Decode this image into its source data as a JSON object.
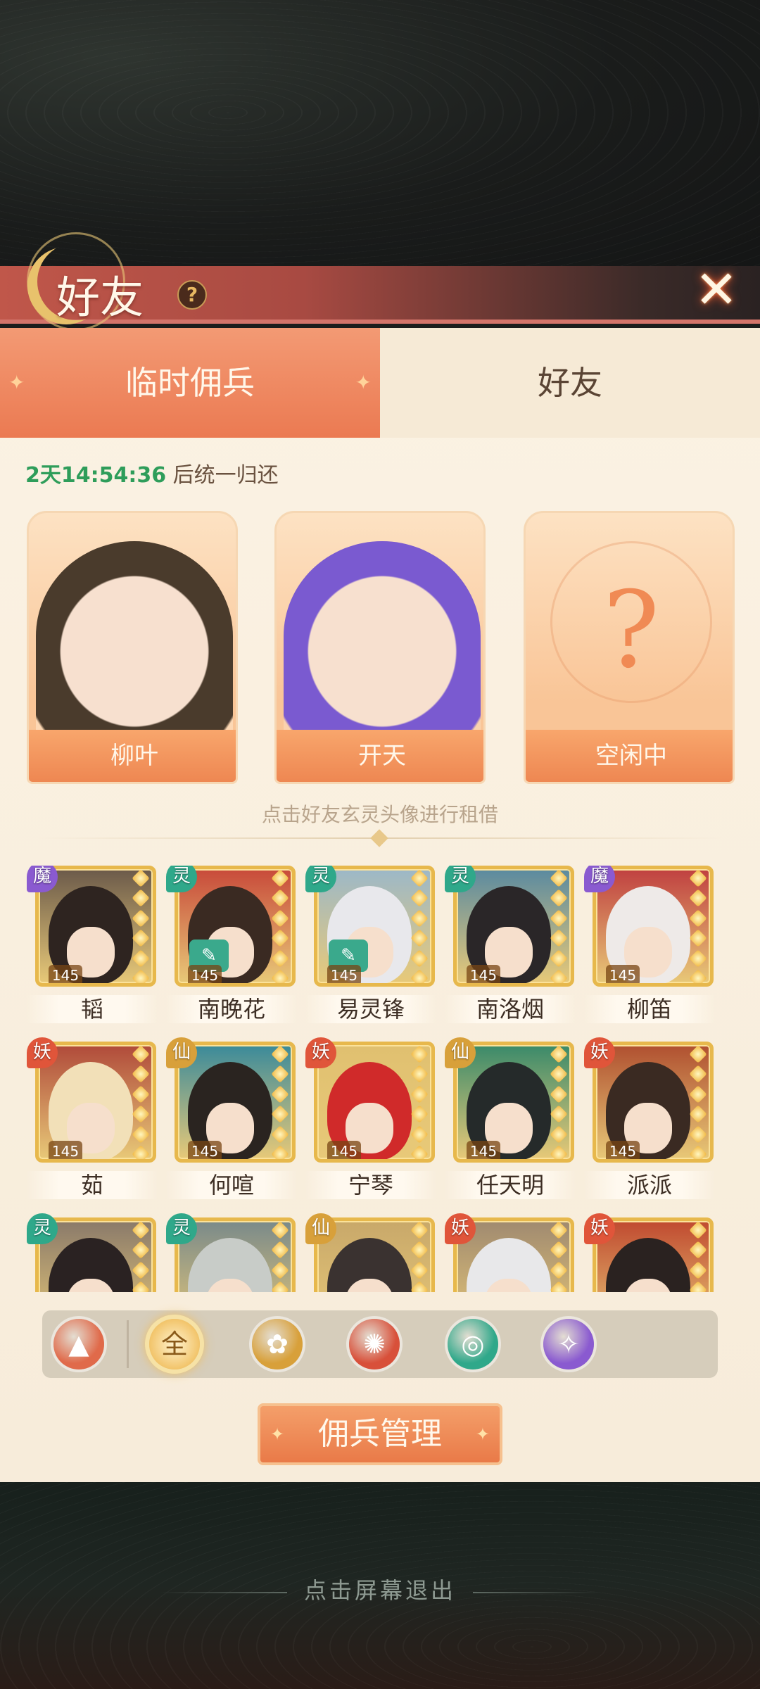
{
  "header": {
    "title": "好友",
    "help": "?",
    "close": "✕"
  },
  "tabs": [
    {
      "label": "临时佣兵",
      "active": true
    },
    {
      "label": "好友",
      "active": false
    }
  ],
  "timer": {
    "time": "2天14:54:36",
    "suffix": " 后统一归还"
  },
  "mercenaries": [
    {
      "name": "柳叶",
      "hair": "#4a3b2c",
      "bg": "#fdd8b4"
    },
    {
      "name": "开天",
      "hair": "#7a5ad0",
      "bg": "#fbd2ad"
    },
    {
      "name": "空闲中",
      "placeholder": "?"
    }
  ],
  "rent_hint": "点击好友玄灵头像进行租借",
  "characters": [
    {
      "name": "韬",
      "element": "魔",
      "level": "145",
      "color": "#8a5ad0",
      "hair": "#2e2420",
      "bg": "#6b5a4a",
      "lent": false
    },
    {
      "name": "南晚花",
      "element": "灵",
      "level": "145",
      "color": "#2fa88a",
      "hair": "#3a2a22",
      "bg": "#c84a3a",
      "lent": true
    },
    {
      "name": "易灵锋",
      "element": "灵",
      "level": "145",
      "color": "#2fa88a",
      "hair": "#e8e8ec",
      "bg": "#9cb8c8",
      "lent": true
    },
    {
      "name": "南洛烟",
      "element": "灵",
      "level": "145",
      "color": "#2fa88a",
      "hair": "#2a2628",
      "bg": "#5a8aa0",
      "lent": false
    },
    {
      "name": "柳笛",
      "element": "魔",
      "level": "145",
      "color": "#8a5ad0",
      "hair": "#eeeae8",
      "bg": "#c04040",
      "lent": false
    },
    {
      "name": "茹",
      "element": "妖",
      "level": "145",
      "color": "#e0553a",
      "hair": "#f2e0b8",
      "bg": "#b04a3a",
      "lent": false
    },
    {
      "name": "何喧",
      "element": "仙",
      "level": "145",
      "color": "#d8a03a",
      "hair": "#2a2420",
      "bg": "#3a8a9a",
      "lent": false
    },
    {
      "name": "宁琴",
      "element": "妖",
      "level": "145",
      "color": "#e0553a",
      "hair": "#d02a2a",
      "bg": "#e0c070",
      "lent": false
    },
    {
      "name": "任天明",
      "element": "仙",
      "level": "145",
      "color": "#d8a03a",
      "hair": "#252a2a",
      "bg": "#3a8a6a",
      "lent": false
    },
    {
      "name": "派派",
      "element": "妖",
      "level": "145",
      "color": "#e0553a",
      "hair": "#3a2a22",
      "bg": "#b05030",
      "lent": false
    },
    {
      "name": "",
      "element": "灵",
      "level": "",
      "color": "#2fa88a",
      "hair": "#2a2222",
      "bg": "#8a7a6a",
      "lent": false
    },
    {
      "name": "",
      "element": "灵",
      "level": "",
      "color": "#2fa88a",
      "hair": "#c8ccc8",
      "bg": "#7a8a8a",
      "lent": false
    },
    {
      "name": "",
      "element": "仙",
      "level": "",
      "color": "#d8a03a",
      "hair": "#3a3230",
      "bg": "#c8a86a",
      "lent": false
    },
    {
      "name": "",
      "element": "妖",
      "level": "",
      "color": "#e0553a",
      "hair": "#e8e8ea",
      "bg": "#a08a70",
      "lent": false
    },
    {
      "name": "",
      "element": "妖",
      "level": "",
      "color": "#e0553a",
      "hair": "#2a2220",
      "bg": "#c04a30",
      "lent": false
    }
  ],
  "filters": [
    {
      "label": "▲",
      "icon": "triangle-icon",
      "color": "#e06a4a"
    },
    {
      "label": "全",
      "icon": "all-icon",
      "color": "#d8a24a",
      "active": true
    },
    {
      "label": "✿",
      "icon": "lotus-icon",
      "color": "#d8a03a"
    },
    {
      "label": "✺",
      "icon": "demon-icon",
      "color": "#d8503a"
    },
    {
      "label": "◎",
      "icon": "spirit-icon",
      "color": "#2fa88a"
    },
    {
      "label": "✧",
      "icon": "mo-icon",
      "color": "#8a5ad0"
    }
  ],
  "manage_button": "佣兵管理",
  "exit_hint": "点击屏幕退出"
}
